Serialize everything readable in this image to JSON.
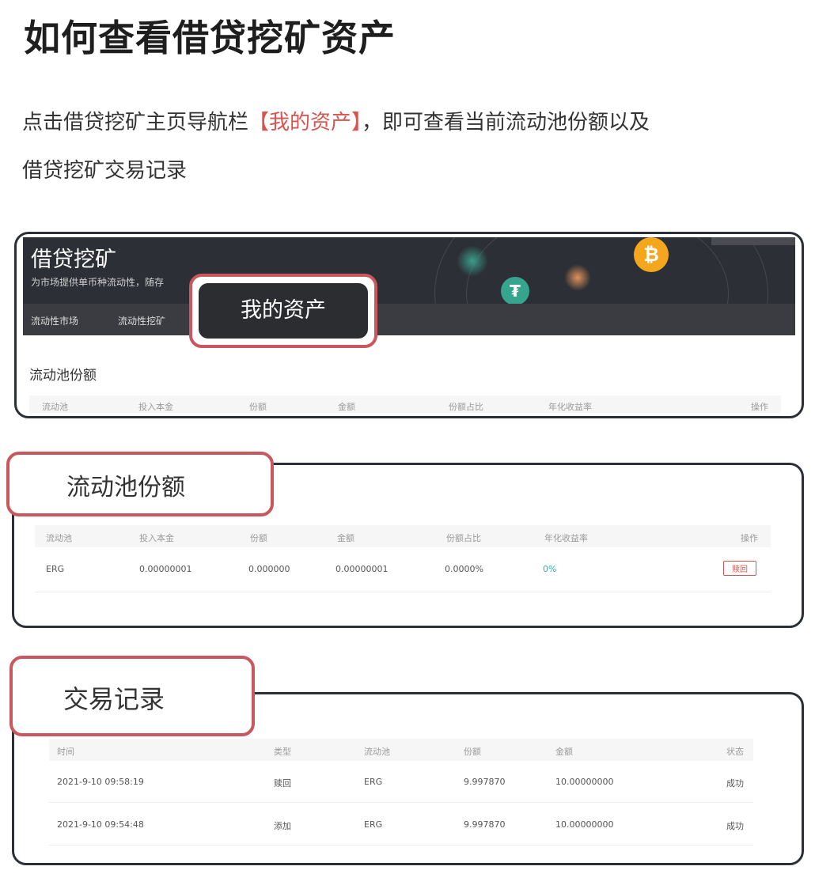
{
  "title": "如何查看借贷挖矿资产",
  "intro": {
    "line1_prefix": "点击借贷挖矿主页导航栏",
    "line1_highlight": "【我的资产】",
    "line1_suffix": "，即可查看当前流动池份额以及",
    "line2": "借贷挖矿交易记录"
  },
  "colors": {
    "highlight": "#d9534f",
    "callout_border": "#c9575d",
    "frame_border": "#2b2f38",
    "teal_percent": "#2bb3a0"
  },
  "shot1": {
    "app_title": "借贷挖矿",
    "subtitle": "为市场提供单币种流动性，随存",
    "nav": [
      "流动性市场",
      "流动性挖矿"
    ],
    "my_assets_button": "我的资产",
    "section_title": "流动池份额",
    "columns": [
      "流动池",
      "投入本金",
      "份额",
      "金额",
      "份额占比",
      "年化收益率",
      "操作"
    ],
    "icons": [
      "bitcoin-icon",
      "tether-icon"
    ]
  },
  "pool": {
    "callout_label": "流动池份额",
    "columns": [
      "流动池",
      "投入本金",
      "份额",
      "金额",
      "份额占比",
      "年化收益率",
      "操作"
    ],
    "row": {
      "pool": "ERG",
      "principal": "0.00000001",
      "shares": "0.000000",
      "amount": "0.00000001",
      "share_ratio": "0.0000%",
      "apy": "0%",
      "action": "赎回"
    }
  },
  "records": {
    "callout_label": "交易记录",
    "columns": [
      "时间",
      "类型",
      "流动池",
      "份额",
      "金额",
      "状态"
    ],
    "rows": [
      {
        "time": "2021-9-10 09:58:19",
        "type": "赎回",
        "pool": "ERG",
        "shares": "9.997870",
        "amount": "10.00000000",
        "status": "成功"
      },
      {
        "time": "2021-9-10 09:54:48",
        "type": "添加",
        "pool": "ERG",
        "shares": "9.997870",
        "amount": "10.00000000",
        "status": "成功"
      }
    ]
  }
}
